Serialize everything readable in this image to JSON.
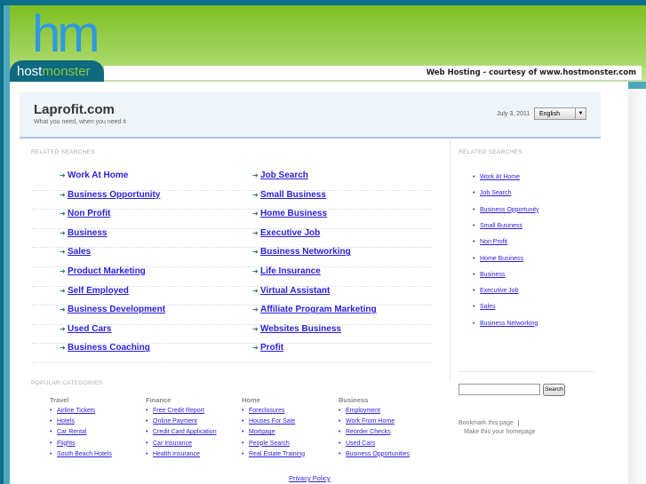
{
  "header": {
    "logo_text_host": "host",
    "logo_text_monster": "monster",
    "tagline": "Web Hosting - courtesy of www.hostmonster.com"
  },
  "site": {
    "title": "Laprofit.com",
    "subtitle": "What you need, when you need it",
    "date": "July 3, 2011",
    "language": "English"
  },
  "related_label": "RELATED SEARCHES",
  "related": [
    [
      "Work At Home",
      "Job Search"
    ],
    [
      "Business Opportunity",
      "Small Business"
    ],
    [
      "Non Profit",
      "Home Business"
    ],
    [
      "Business",
      "Executive Job"
    ],
    [
      "Sales",
      "Business Networking"
    ],
    [
      "Product Marketing",
      "Life Insurance"
    ],
    [
      "Self Employed",
      "Virtual Assistant"
    ],
    [
      "Business Development",
      "Affiliate Program Marketing"
    ],
    [
      "Used Cars",
      "Websites Business"
    ],
    [
      "Business Coaching",
      "Profit"
    ]
  ],
  "sidebar": {
    "label": "RELATED SEARCHES",
    "items": [
      "Work At Home",
      "Job Search",
      "Business Opportunity",
      "Small Business",
      "Non Profit",
      "Home Business",
      "Business",
      "Executive Job",
      "Sales",
      "Business Networking"
    ],
    "search_button": "Search",
    "bookmark": "Bookmark this page",
    "homepage": "Make this your homepage"
  },
  "popular_label": "POPULAR CATEGORIES",
  "categories": [
    {
      "title": "Travel",
      "items": [
        "Airline Tickets",
        "Hotels",
        "Car Rental",
        "Flights",
        "South Beach Hotels"
      ]
    },
    {
      "title": "Finance",
      "items": [
        "Free Credit Report",
        "Online Payment",
        "Credit Card Application",
        "Car Insurance",
        "Health Insurance"
      ]
    },
    {
      "title": "Home",
      "items": [
        "Foreclosures",
        "Houses For Sale",
        "Mortgage",
        "People Search",
        "Real Estate Training"
      ]
    },
    {
      "title": "Business",
      "items": [
        "Employment",
        "Work From Home",
        "Reorder Checks",
        "Used Cars",
        "Business Opportunities"
      ]
    }
  ],
  "footer": {
    "privacy": "Privacy Policy"
  }
}
